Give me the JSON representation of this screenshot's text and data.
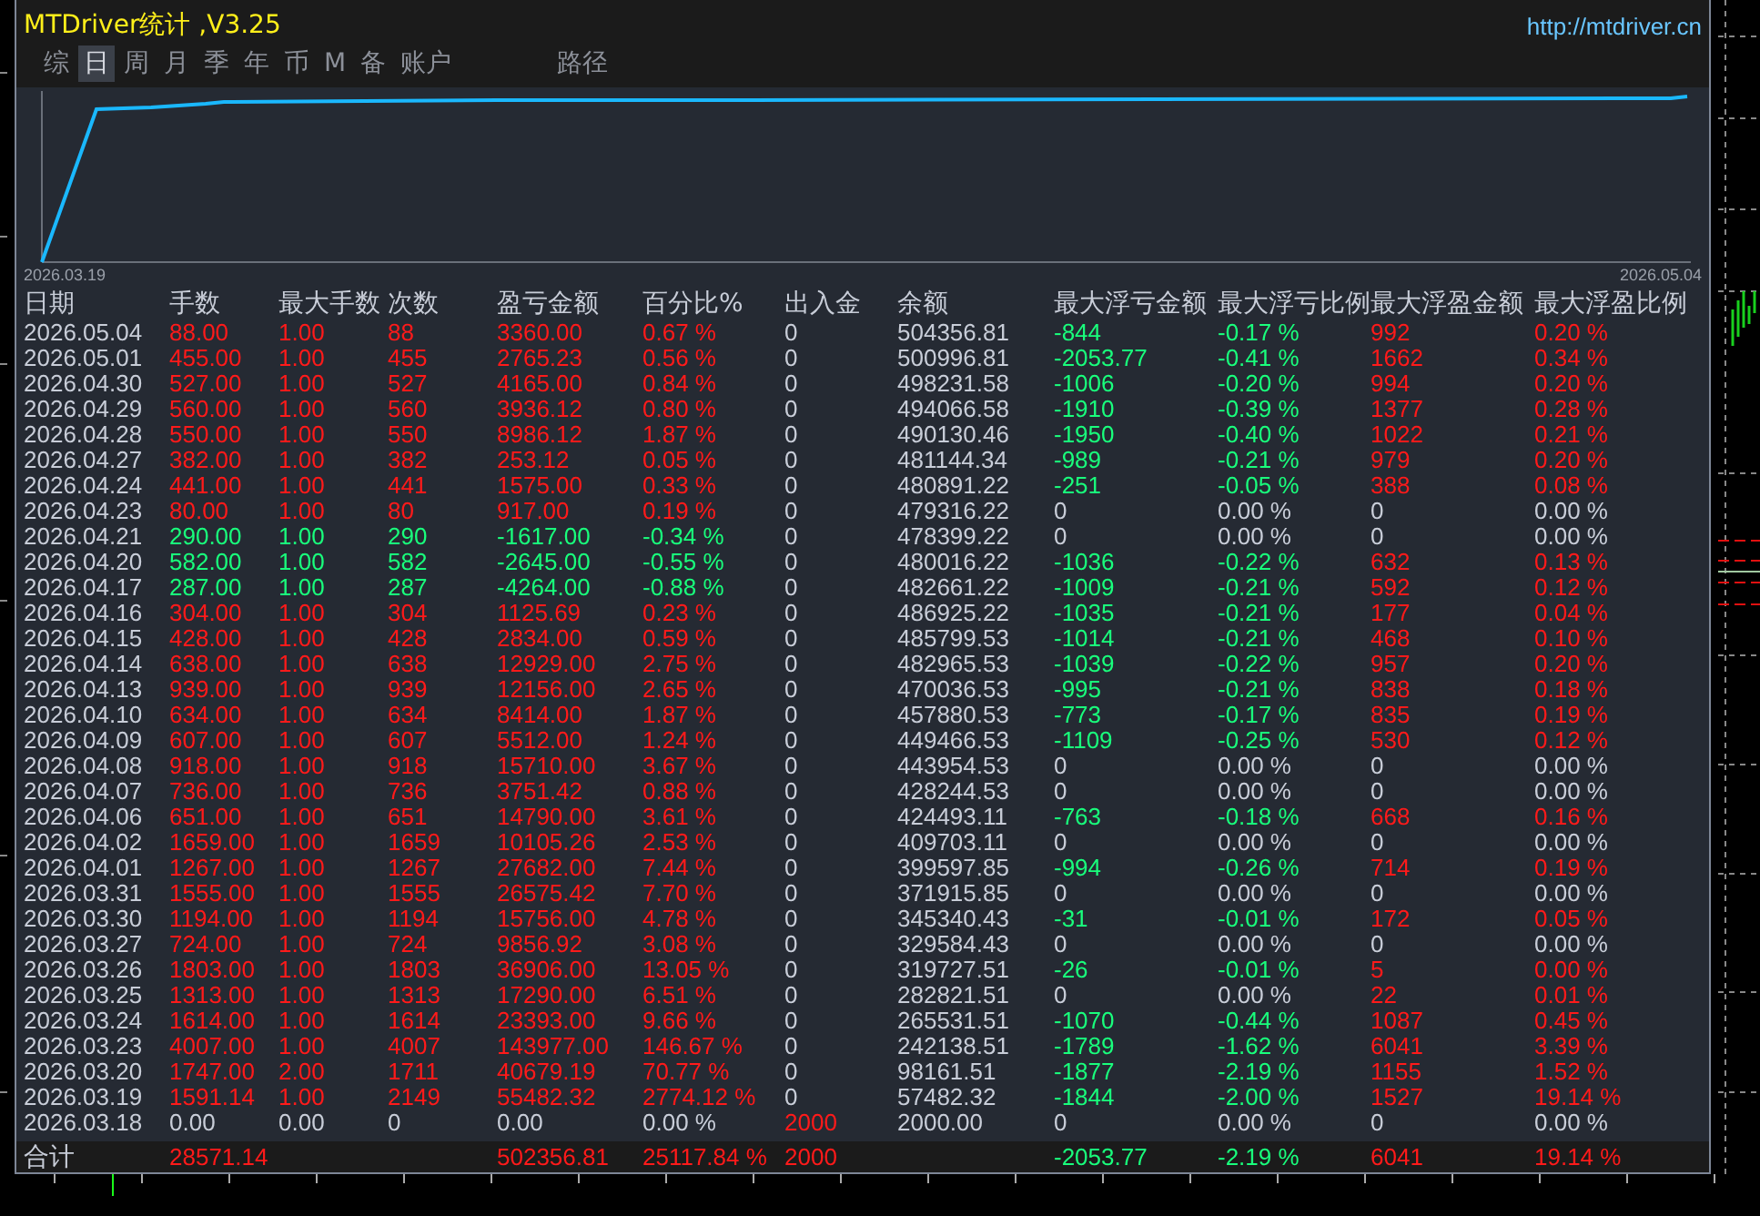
{
  "window": {
    "title": "MTDriver统计 ,V3.25",
    "url": "http://mtdriver.cn"
  },
  "tabs": [
    {
      "label": "综",
      "selected": false
    },
    {
      "label": "日",
      "selected": true
    },
    {
      "label": "周",
      "selected": false
    },
    {
      "label": "月",
      "selected": false
    },
    {
      "label": "季",
      "selected": false
    },
    {
      "label": "年",
      "selected": false
    },
    {
      "label": "币",
      "selected": false
    },
    {
      "label": "M",
      "selected": false
    },
    {
      "label": "备",
      "selected": false
    },
    {
      "label": "账户",
      "selected": false
    },
    {
      "label": "路径",
      "selected": false
    }
  ],
  "chart": {
    "start_label": "2026.03.19",
    "end_label": "2026.05.04"
  },
  "table": {
    "columns": [
      "日期",
      "手数",
      "最大手数",
      "次数",
      "盈亏金额",
      "百分比%",
      "出入金",
      "余额",
      "最大浮亏金额",
      "最大浮亏比例",
      "最大浮盈金额",
      "最大浮盈比例"
    ],
    "rows": [
      [
        {
          "text": "2026.05.04",
          "color": "#c8cdd8"
        },
        {
          "text": "88.00",
          "color": "#ff1a1a"
        },
        {
          "text": "1.00",
          "color": "#ff1a1a"
        },
        {
          "text": "88",
          "color": "#ff1a1a"
        },
        {
          "text": "3360.00",
          "color": "#ff1a1a"
        },
        {
          "text": "0.67 %",
          "color": "#ff1a1a"
        },
        {
          "text": "0",
          "color": "#c8cdd8"
        },
        {
          "text": "504356.81",
          "color": "#c8cdd8"
        },
        {
          "text": "-844",
          "color": "#19ff7c"
        },
        {
          "text": "-0.17 %",
          "color": "#19ff7c"
        },
        {
          "text": "992",
          "color": "#ff1a1a"
        },
        {
          "text": "0.20 %",
          "color": "#ff1a1a"
        }
      ],
      [
        {
          "text": "2026.05.01",
          "color": "#c8cdd8"
        },
        {
          "text": "455.00",
          "color": "#ff1a1a"
        },
        {
          "text": "1.00",
          "color": "#ff1a1a"
        },
        {
          "text": "455",
          "color": "#ff1a1a"
        },
        {
          "text": "2765.23",
          "color": "#ff1a1a"
        },
        {
          "text": "0.56 %",
          "color": "#ff1a1a"
        },
        {
          "text": "0",
          "color": "#c8cdd8"
        },
        {
          "text": "500996.81",
          "color": "#c8cdd8"
        },
        {
          "text": "-2053.77",
          "color": "#19ff7c"
        },
        {
          "text": "-0.41 %",
          "color": "#19ff7c"
        },
        {
          "text": "1662",
          "color": "#ff1a1a"
        },
        {
          "text": "0.34 %",
          "color": "#ff1a1a"
        }
      ],
      [
        {
          "text": "2026.04.30",
          "color": "#c8cdd8"
        },
        {
          "text": "527.00",
          "color": "#ff1a1a"
        },
        {
          "text": "1.00",
          "color": "#ff1a1a"
        },
        {
          "text": "527",
          "color": "#ff1a1a"
        },
        {
          "text": "4165.00",
          "color": "#ff1a1a"
        },
        {
          "text": "0.84 %",
          "color": "#ff1a1a"
        },
        {
          "text": "0",
          "color": "#c8cdd8"
        },
        {
          "text": "498231.58",
          "color": "#c8cdd8"
        },
        {
          "text": "-1006",
          "color": "#19ff7c"
        },
        {
          "text": "-0.20 %",
          "color": "#19ff7c"
        },
        {
          "text": "994",
          "color": "#ff1a1a"
        },
        {
          "text": "0.20 %",
          "color": "#ff1a1a"
        }
      ],
      [
        {
          "text": "2026.04.29",
          "color": "#c8cdd8"
        },
        {
          "text": "560.00",
          "color": "#ff1a1a"
        },
        {
          "text": "1.00",
          "color": "#ff1a1a"
        },
        {
          "text": "560",
          "color": "#ff1a1a"
        },
        {
          "text": "3936.12",
          "color": "#ff1a1a"
        },
        {
          "text": "0.80 %",
          "color": "#ff1a1a"
        },
        {
          "text": "0",
          "color": "#c8cdd8"
        },
        {
          "text": "494066.58",
          "color": "#c8cdd8"
        },
        {
          "text": "-1910",
          "color": "#19ff7c"
        },
        {
          "text": "-0.39 %",
          "color": "#19ff7c"
        },
        {
          "text": "1377",
          "color": "#ff1a1a"
        },
        {
          "text": "0.28 %",
          "color": "#ff1a1a"
        }
      ],
      [
        {
          "text": "2026.04.28",
          "color": "#c8cdd8"
        },
        {
          "text": "550.00",
          "color": "#ff1a1a"
        },
        {
          "text": "1.00",
          "color": "#ff1a1a"
        },
        {
          "text": "550",
          "color": "#ff1a1a"
        },
        {
          "text": "8986.12",
          "color": "#ff1a1a"
        },
        {
          "text": "1.87 %",
          "color": "#ff1a1a"
        },
        {
          "text": "0",
          "color": "#c8cdd8"
        },
        {
          "text": "490130.46",
          "color": "#c8cdd8"
        },
        {
          "text": "-1950",
          "color": "#19ff7c"
        },
        {
          "text": "-0.40 %",
          "color": "#19ff7c"
        },
        {
          "text": "1022",
          "color": "#ff1a1a"
        },
        {
          "text": "0.21 %",
          "color": "#ff1a1a"
        }
      ],
      [
        {
          "text": "2026.04.27",
          "color": "#c8cdd8"
        },
        {
          "text": "382.00",
          "color": "#ff1a1a"
        },
        {
          "text": "1.00",
          "color": "#ff1a1a"
        },
        {
          "text": "382",
          "color": "#ff1a1a"
        },
        {
          "text": "253.12",
          "color": "#ff1a1a"
        },
        {
          "text": "0.05 %",
          "color": "#ff1a1a"
        },
        {
          "text": "0",
          "color": "#c8cdd8"
        },
        {
          "text": "481144.34",
          "color": "#c8cdd8"
        },
        {
          "text": "-989",
          "color": "#19ff7c"
        },
        {
          "text": "-0.21 %",
          "color": "#19ff7c"
        },
        {
          "text": "979",
          "color": "#ff1a1a"
        },
        {
          "text": "0.20 %",
          "color": "#ff1a1a"
        }
      ],
      [
        {
          "text": "2026.04.24",
          "color": "#c8cdd8"
        },
        {
          "text": "441.00",
          "color": "#ff1a1a"
        },
        {
          "text": "1.00",
          "color": "#ff1a1a"
        },
        {
          "text": "441",
          "color": "#ff1a1a"
        },
        {
          "text": "1575.00",
          "color": "#ff1a1a"
        },
        {
          "text": "0.33 %",
          "color": "#ff1a1a"
        },
        {
          "text": "0",
          "color": "#c8cdd8"
        },
        {
          "text": "480891.22",
          "color": "#c8cdd8"
        },
        {
          "text": "-251",
          "color": "#19ff7c"
        },
        {
          "text": "-0.05 %",
          "color": "#19ff7c"
        },
        {
          "text": "388",
          "color": "#ff1a1a"
        },
        {
          "text": "0.08 %",
          "color": "#ff1a1a"
        }
      ],
      [
        {
          "text": "2026.04.23",
          "color": "#c8cdd8"
        },
        {
          "text": "80.00",
          "color": "#ff1a1a"
        },
        {
          "text": "1.00",
          "color": "#ff1a1a"
        },
        {
          "text": "80",
          "color": "#ff1a1a"
        },
        {
          "text": "917.00",
          "color": "#ff1a1a"
        },
        {
          "text": "0.19 %",
          "color": "#ff1a1a"
        },
        {
          "text": "0",
          "color": "#c8cdd8"
        },
        {
          "text": "479316.22",
          "color": "#c8cdd8"
        },
        {
          "text": "0",
          "color": "#c8cdd8"
        },
        {
          "text": "0.00 %",
          "color": "#c8cdd8"
        },
        {
          "text": "0",
          "color": "#c8cdd8"
        },
        {
          "text": "0.00 %",
          "color": "#c8cdd8"
        }
      ],
      [
        {
          "text": "2026.04.21",
          "color": "#c8cdd8"
        },
        {
          "text": "290.00",
          "color": "#19ff7c"
        },
        {
          "text": "1.00",
          "color": "#19ff7c"
        },
        {
          "text": "290",
          "color": "#19ff7c"
        },
        {
          "text": "-1617.00",
          "color": "#19ff7c"
        },
        {
          "text": "-0.34 %",
          "color": "#19ff7c"
        },
        {
          "text": "0",
          "color": "#c8cdd8"
        },
        {
          "text": "478399.22",
          "color": "#c8cdd8"
        },
        {
          "text": "0",
          "color": "#c8cdd8"
        },
        {
          "text": "0.00 %",
          "color": "#c8cdd8"
        },
        {
          "text": "0",
          "color": "#c8cdd8"
        },
        {
          "text": "0.00 %",
          "color": "#c8cdd8"
        }
      ],
      [
        {
          "text": "2026.04.20",
          "color": "#c8cdd8"
        },
        {
          "text": "582.00",
          "color": "#19ff7c"
        },
        {
          "text": "1.00",
          "color": "#19ff7c"
        },
        {
          "text": "582",
          "color": "#19ff7c"
        },
        {
          "text": "-2645.00",
          "color": "#19ff7c"
        },
        {
          "text": "-0.55 %",
          "color": "#19ff7c"
        },
        {
          "text": "0",
          "color": "#c8cdd8"
        },
        {
          "text": "480016.22",
          "color": "#c8cdd8"
        },
        {
          "text": "-1036",
          "color": "#19ff7c"
        },
        {
          "text": "-0.22 %",
          "color": "#19ff7c"
        },
        {
          "text": "632",
          "color": "#ff1a1a"
        },
        {
          "text": "0.13 %",
          "color": "#ff1a1a"
        }
      ],
      [
        {
          "text": "2026.04.17",
          "color": "#c8cdd8"
        },
        {
          "text": "287.00",
          "color": "#19ff7c"
        },
        {
          "text": "1.00",
          "color": "#19ff7c"
        },
        {
          "text": "287",
          "color": "#19ff7c"
        },
        {
          "text": "-4264.00",
          "color": "#19ff7c"
        },
        {
          "text": "-0.88 %",
          "color": "#19ff7c"
        },
        {
          "text": "0",
          "color": "#c8cdd8"
        },
        {
          "text": "482661.22",
          "color": "#c8cdd8"
        },
        {
          "text": "-1009",
          "color": "#19ff7c"
        },
        {
          "text": "-0.21 %",
          "color": "#19ff7c"
        },
        {
          "text": "592",
          "color": "#ff1a1a"
        },
        {
          "text": "0.12 %",
          "color": "#ff1a1a"
        }
      ],
      [
        {
          "text": "2026.04.16",
          "color": "#c8cdd8"
        },
        {
          "text": "304.00",
          "color": "#ff1a1a"
        },
        {
          "text": "1.00",
          "color": "#ff1a1a"
        },
        {
          "text": "304",
          "color": "#ff1a1a"
        },
        {
          "text": "1125.69",
          "color": "#ff1a1a"
        },
        {
          "text": "0.23 %",
          "color": "#ff1a1a"
        },
        {
          "text": "0",
          "color": "#c8cdd8"
        },
        {
          "text": "486925.22",
          "color": "#c8cdd8"
        },
        {
          "text": "-1035",
          "color": "#19ff7c"
        },
        {
          "text": "-0.21 %",
          "color": "#19ff7c"
        },
        {
          "text": "177",
          "color": "#ff1a1a"
        },
        {
          "text": "0.04 %",
          "color": "#ff1a1a"
        }
      ],
      [
        {
          "text": "2026.04.15",
          "color": "#c8cdd8"
        },
        {
          "text": "428.00",
          "color": "#ff1a1a"
        },
        {
          "text": "1.00",
          "color": "#ff1a1a"
        },
        {
          "text": "428",
          "color": "#ff1a1a"
        },
        {
          "text": "2834.00",
          "color": "#ff1a1a"
        },
        {
          "text": "0.59 %",
          "color": "#ff1a1a"
        },
        {
          "text": "0",
          "color": "#c8cdd8"
        },
        {
          "text": "485799.53",
          "color": "#c8cdd8"
        },
        {
          "text": "-1014",
          "color": "#19ff7c"
        },
        {
          "text": "-0.21 %",
          "color": "#19ff7c"
        },
        {
          "text": "468",
          "color": "#ff1a1a"
        },
        {
          "text": "0.10 %",
          "color": "#ff1a1a"
        }
      ],
      [
        {
          "text": "2026.04.14",
          "color": "#c8cdd8"
        },
        {
          "text": "638.00",
          "color": "#ff1a1a"
        },
        {
          "text": "1.00",
          "color": "#ff1a1a"
        },
        {
          "text": "638",
          "color": "#ff1a1a"
        },
        {
          "text": "12929.00",
          "color": "#ff1a1a"
        },
        {
          "text": "2.75 %",
          "color": "#ff1a1a"
        },
        {
          "text": "0",
          "color": "#c8cdd8"
        },
        {
          "text": "482965.53",
          "color": "#c8cdd8"
        },
        {
          "text": "-1039",
          "color": "#19ff7c"
        },
        {
          "text": "-0.22 %",
          "color": "#19ff7c"
        },
        {
          "text": "957",
          "color": "#ff1a1a"
        },
        {
          "text": "0.20 %",
          "color": "#ff1a1a"
        }
      ],
      [
        {
          "text": "2026.04.13",
          "color": "#c8cdd8"
        },
        {
          "text": "939.00",
          "color": "#ff1a1a"
        },
        {
          "text": "1.00",
          "color": "#ff1a1a"
        },
        {
          "text": "939",
          "color": "#ff1a1a"
        },
        {
          "text": "12156.00",
          "color": "#ff1a1a"
        },
        {
          "text": "2.65 %",
          "color": "#ff1a1a"
        },
        {
          "text": "0",
          "color": "#c8cdd8"
        },
        {
          "text": "470036.53",
          "color": "#c8cdd8"
        },
        {
          "text": "-995",
          "color": "#19ff7c"
        },
        {
          "text": "-0.21 %",
          "color": "#19ff7c"
        },
        {
          "text": "838",
          "color": "#ff1a1a"
        },
        {
          "text": "0.18 %",
          "color": "#ff1a1a"
        }
      ],
      [
        {
          "text": "2026.04.10",
          "color": "#c8cdd8"
        },
        {
          "text": "634.00",
          "color": "#ff1a1a"
        },
        {
          "text": "1.00",
          "color": "#ff1a1a"
        },
        {
          "text": "634",
          "color": "#ff1a1a"
        },
        {
          "text": "8414.00",
          "color": "#ff1a1a"
        },
        {
          "text": "1.87 %",
          "color": "#ff1a1a"
        },
        {
          "text": "0",
          "color": "#c8cdd8"
        },
        {
          "text": "457880.53",
          "color": "#c8cdd8"
        },
        {
          "text": "-773",
          "color": "#19ff7c"
        },
        {
          "text": "-0.17 %",
          "color": "#19ff7c"
        },
        {
          "text": "835",
          "color": "#ff1a1a"
        },
        {
          "text": "0.19 %",
          "color": "#ff1a1a"
        }
      ],
      [
        {
          "text": "2026.04.09",
          "color": "#c8cdd8"
        },
        {
          "text": "607.00",
          "color": "#ff1a1a"
        },
        {
          "text": "1.00",
          "color": "#ff1a1a"
        },
        {
          "text": "607",
          "color": "#ff1a1a"
        },
        {
          "text": "5512.00",
          "color": "#ff1a1a"
        },
        {
          "text": "1.24 %",
          "color": "#ff1a1a"
        },
        {
          "text": "0",
          "color": "#c8cdd8"
        },
        {
          "text": "449466.53",
          "color": "#c8cdd8"
        },
        {
          "text": "-1109",
          "color": "#19ff7c"
        },
        {
          "text": "-0.25 %",
          "color": "#19ff7c"
        },
        {
          "text": "530",
          "color": "#ff1a1a"
        },
        {
          "text": "0.12 %",
          "color": "#ff1a1a"
        }
      ],
      [
        {
          "text": "2026.04.08",
          "color": "#c8cdd8"
        },
        {
          "text": "918.00",
          "color": "#ff1a1a"
        },
        {
          "text": "1.00",
          "color": "#ff1a1a"
        },
        {
          "text": "918",
          "color": "#ff1a1a"
        },
        {
          "text": "15710.00",
          "color": "#ff1a1a"
        },
        {
          "text": "3.67 %",
          "color": "#ff1a1a"
        },
        {
          "text": "0",
          "color": "#c8cdd8"
        },
        {
          "text": "443954.53",
          "color": "#c8cdd8"
        },
        {
          "text": "0",
          "color": "#c8cdd8"
        },
        {
          "text": "0.00 %",
          "color": "#c8cdd8"
        },
        {
          "text": "0",
          "color": "#c8cdd8"
        },
        {
          "text": "0.00 %",
          "color": "#c8cdd8"
        }
      ],
      [
        {
          "text": "2026.04.07",
          "color": "#c8cdd8"
        },
        {
          "text": "736.00",
          "color": "#ff1a1a"
        },
        {
          "text": "1.00",
          "color": "#ff1a1a"
        },
        {
          "text": "736",
          "color": "#ff1a1a"
        },
        {
          "text": "3751.42",
          "color": "#ff1a1a"
        },
        {
          "text": "0.88 %",
          "color": "#ff1a1a"
        },
        {
          "text": "0",
          "color": "#c8cdd8"
        },
        {
          "text": "428244.53",
          "color": "#c8cdd8"
        },
        {
          "text": "0",
          "color": "#c8cdd8"
        },
        {
          "text": "0.00 %",
          "color": "#c8cdd8"
        },
        {
          "text": "0",
          "color": "#c8cdd8"
        },
        {
          "text": "0.00 %",
          "color": "#c8cdd8"
        }
      ],
      [
        {
          "text": "2026.04.06",
          "color": "#c8cdd8"
        },
        {
          "text": "651.00",
          "color": "#ff1a1a"
        },
        {
          "text": "1.00",
          "color": "#ff1a1a"
        },
        {
          "text": "651",
          "color": "#ff1a1a"
        },
        {
          "text": "14790.00",
          "color": "#ff1a1a"
        },
        {
          "text": "3.61 %",
          "color": "#ff1a1a"
        },
        {
          "text": "0",
          "color": "#c8cdd8"
        },
        {
          "text": "424493.11",
          "color": "#c8cdd8"
        },
        {
          "text": "-763",
          "color": "#19ff7c"
        },
        {
          "text": "-0.18 %",
          "color": "#19ff7c"
        },
        {
          "text": "668",
          "color": "#ff1a1a"
        },
        {
          "text": "0.16 %",
          "color": "#ff1a1a"
        }
      ],
      [
        {
          "text": "2026.04.02",
          "color": "#c8cdd8"
        },
        {
          "text": "1659.00",
          "color": "#ff1a1a"
        },
        {
          "text": "1.00",
          "color": "#ff1a1a"
        },
        {
          "text": "1659",
          "color": "#ff1a1a"
        },
        {
          "text": "10105.26",
          "color": "#ff1a1a"
        },
        {
          "text": "2.53 %",
          "color": "#ff1a1a"
        },
        {
          "text": "0",
          "color": "#c8cdd8"
        },
        {
          "text": "409703.11",
          "color": "#c8cdd8"
        },
        {
          "text": "0",
          "color": "#c8cdd8"
        },
        {
          "text": "0.00 %",
          "color": "#c8cdd8"
        },
        {
          "text": "0",
          "color": "#c8cdd8"
        },
        {
          "text": "0.00 %",
          "color": "#c8cdd8"
        }
      ],
      [
        {
          "text": "2026.04.01",
          "color": "#c8cdd8"
        },
        {
          "text": "1267.00",
          "color": "#ff1a1a"
        },
        {
          "text": "1.00",
          "color": "#ff1a1a"
        },
        {
          "text": "1267",
          "color": "#ff1a1a"
        },
        {
          "text": "27682.00",
          "color": "#ff1a1a"
        },
        {
          "text": "7.44 %",
          "color": "#ff1a1a"
        },
        {
          "text": "0",
          "color": "#c8cdd8"
        },
        {
          "text": "399597.85",
          "color": "#c8cdd8"
        },
        {
          "text": "-994",
          "color": "#19ff7c"
        },
        {
          "text": "-0.26 %",
          "color": "#19ff7c"
        },
        {
          "text": "714",
          "color": "#ff1a1a"
        },
        {
          "text": "0.19 %",
          "color": "#ff1a1a"
        }
      ],
      [
        {
          "text": "2026.03.31",
          "color": "#c8cdd8"
        },
        {
          "text": "1555.00",
          "color": "#ff1a1a"
        },
        {
          "text": "1.00",
          "color": "#ff1a1a"
        },
        {
          "text": "1555",
          "color": "#ff1a1a"
        },
        {
          "text": "26575.42",
          "color": "#ff1a1a"
        },
        {
          "text": "7.70 %",
          "color": "#ff1a1a"
        },
        {
          "text": "0",
          "color": "#c8cdd8"
        },
        {
          "text": "371915.85",
          "color": "#c8cdd8"
        },
        {
          "text": "0",
          "color": "#c8cdd8"
        },
        {
          "text": "0.00 %",
          "color": "#c8cdd8"
        },
        {
          "text": "0",
          "color": "#c8cdd8"
        },
        {
          "text": "0.00 %",
          "color": "#c8cdd8"
        }
      ],
      [
        {
          "text": "2026.03.30",
          "color": "#c8cdd8"
        },
        {
          "text": "1194.00",
          "color": "#ff1a1a"
        },
        {
          "text": "1.00",
          "color": "#ff1a1a"
        },
        {
          "text": "1194",
          "color": "#ff1a1a"
        },
        {
          "text": "15756.00",
          "color": "#ff1a1a"
        },
        {
          "text": "4.78 %",
          "color": "#ff1a1a"
        },
        {
          "text": "0",
          "color": "#c8cdd8"
        },
        {
          "text": "345340.43",
          "color": "#c8cdd8"
        },
        {
          "text": "-31",
          "color": "#19ff7c"
        },
        {
          "text": "-0.01 %",
          "color": "#19ff7c"
        },
        {
          "text": "172",
          "color": "#ff1a1a"
        },
        {
          "text": "0.05 %",
          "color": "#ff1a1a"
        }
      ],
      [
        {
          "text": "2026.03.27",
          "color": "#c8cdd8"
        },
        {
          "text": "724.00",
          "color": "#ff1a1a"
        },
        {
          "text": "1.00",
          "color": "#ff1a1a"
        },
        {
          "text": "724",
          "color": "#ff1a1a"
        },
        {
          "text": "9856.92",
          "color": "#ff1a1a"
        },
        {
          "text": "3.08 %",
          "color": "#ff1a1a"
        },
        {
          "text": "0",
          "color": "#c8cdd8"
        },
        {
          "text": "329584.43",
          "color": "#c8cdd8"
        },
        {
          "text": "0",
          "color": "#c8cdd8"
        },
        {
          "text": "0.00 %",
          "color": "#c8cdd8"
        },
        {
          "text": "0",
          "color": "#c8cdd8"
        },
        {
          "text": "0.00 %",
          "color": "#c8cdd8"
        }
      ],
      [
        {
          "text": "2026.03.26",
          "color": "#c8cdd8"
        },
        {
          "text": "1803.00",
          "color": "#ff1a1a"
        },
        {
          "text": "1.00",
          "color": "#ff1a1a"
        },
        {
          "text": "1803",
          "color": "#ff1a1a"
        },
        {
          "text": "36906.00",
          "color": "#ff1a1a"
        },
        {
          "text": "13.05 %",
          "color": "#ff1a1a"
        },
        {
          "text": "0",
          "color": "#c8cdd8"
        },
        {
          "text": "319727.51",
          "color": "#c8cdd8"
        },
        {
          "text": "-26",
          "color": "#19ff7c"
        },
        {
          "text": "-0.01 %",
          "color": "#19ff7c"
        },
        {
          "text": "5",
          "color": "#ff1a1a"
        },
        {
          "text": "0.00 %",
          "color": "#ff1a1a"
        }
      ],
      [
        {
          "text": "2026.03.25",
          "color": "#c8cdd8"
        },
        {
          "text": "1313.00",
          "color": "#ff1a1a"
        },
        {
          "text": "1.00",
          "color": "#ff1a1a"
        },
        {
          "text": "1313",
          "color": "#ff1a1a"
        },
        {
          "text": "17290.00",
          "color": "#ff1a1a"
        },
        {
          "text": "6.51 %",
          "color": "#ff1a1a"
        },
        {
          "text": "0",
          "color": "#c8cdd8"
        },
        {
          "text": "282821.51",
          "color": "#c8cdd8"
        },
        {
          "text": "0",
          "color": "#c8cdd8"
        },
        {
          "text": "0.00 %",
          "color": "#c8cdd8"
        },
        {
          "text": "22",
          "color": "#ff1a1a"
        },
        {
          "text": "0.01 %",
          "color": "#ff1a1a"
        }
      ],
      [
        {
          "text": "2026.03.24",
          "color": "#c8cdd8"
        },
        {
          "text": "1614.00",
          "color": "#ff1a1a"
        },
        {
          "text": "1.00",
          "color": "#ff1a1a"
        },
        {
          "text": "1614",
          "color": "#ff1a1a"
        },
        {
          "text": "23393.00",
          "color": "#ff1a1a"
        },
        {
          "text": "9.66 %",
          "color": "#ff1a1a"
        },
        {
          "text": "0",
          "color": "#c8cdd8"
        },
        {
          "text": "265531.51",
          "color": "#c8cdd8"
        },
        {
          "text": "-1070",
          "color": "#19ff7c"
        },
        {
          "text": "-0.44 %",
          "color": "#19ff7c"
        },
        {
          "text": "1087",
          "color": "#ff1a1a"
        },
        {
          "text": "0.45 %",
          "color": "#ff1a1a"
        }
      ],
      [
        {
          "text": "2026.03.23",
          "color": "#c8cdd8"
        },
        {
          "text": "4007.00",
          "color": "#ff1a1a"
        },
        {
          "text": "1.00",
          "color": "#ff1a1a"
        },
        {
          "text": "4007",
          "color": "#ff1a1a"
        },
        {
          "text": "143977.00",
          "color": "#ff1a1a"
        },
        {
          "text": "146.67 %",
          "color": "#ff1a1a"
        },
        {
          "text": "0",
          "color": "#c8cdd8"
        },
        {
          "text": "242138.51",
          "color": "#c8cdd8"
        },
        {
          "text": "-1789",
          "color": "#19ff7c"
        },
        {
          "text": "-1.62 %",
          "color": "#19ff7c"
        },
        {
          "text": "6041",
          "color": "#ff1a1a"
        },
        {
          "text": "3.39 %",
          "color": "#ff1a1a"
        }
      ],
      [
        {
          "text": "2026.03.20",
          "color": "#c8cdd8"
        },
        {
          "text": "1747.00",
          "color": "#ff1a1a"
        },
        {
          "text": "2.00",
          "color": "#ff1a1a"
        },
        {
          "text": "1711",
          "color": "#ff1a1a"
        },
        {
          "text": "40679.19",
          "color": "#ff1a1a"
        },
        {
          "text": "70.77 %",
          "color": "#ff1a1a"
        },
        {
          "text": "0",
          "color": "#c8cdd8"
        },
        {
          "text": "98161.51",
          "color": "#c8cdd8"
        },
        {
          "text": "-1877",
          "color": "#19ff7c"
        },
        {
          "text": "-2.19 %",
          "color": "#19ff7c"
        },
        {
          "text": "1155",
          "color": "#ff1a1a"
        },
        {
          "text": "1.52 %",
          "color": "#ff1a1a"
        }
      ],
      [
        {
          "text": "2026.03.19",
          "color": "#c8cdd8"
        },
        {
          "text": "1591.14",
          "color": "#ff1a1a"
        },
        {
          "text": "1.00",
          "color": "#ff1a1a"
        },
        {
          "text": "2149",
          "color": "#ff1a1a"
        },
        {
          "text": "55482.32",
          "color": "#ff1a1a"
        },
        {
          "text": "2774.12 %",
          "color": "#ff1a1a"
        },
        {
          "text": "0",
          "color": "#c8cdd8"
        },
        {
          "text": "57482.32",
          "color": "#c8cdd8"
        },
        {
          "text": "-1844",
          "color": "#19ff7c"
        },
        {
          "text": "-2.00 %",
          "color": "#19ff7c"
        },
        {
          "text": "1527",
          "color": "#ff1a1a"
        },
        {
          "text": "19.14 %",
          "color": "#ff1a1a"
        }
      ],
      [
        {
          "text": "2026.03.18",
          "color": "#c8cdd8"
        },
        {
          "text": "0.00",
          "color": "#c8cdd8"
        },
        {
          "text": "0.00",
          "color": "#c8cdd8"
        },
        {
          "text": "0",
          "color": "#c8cdd8"
        },
        {
          "text": "0.00",
          "color": "#c8cdd8"
        },
        {
          "text": "0.00 %",
          "color": "#c8cdd8"
        },
        {
          "text": "2000",
          "color": "#ff1a1a"
        },
        {
          "text": "2000.00",
          "color": "#c8cdd8"
        },
        {
          "text": "0",
          "color": "#c8cdd8"
        },
        {
          "text": "0.00 %",
          "color": "#c8cdd8"
        },
        {
          "text": "0",
          "color": "#c8cdd8"
        },
        {
          "text": "0.00 %",
          "color": "#c8cdd8"
        }
      ]
    ],
    "total": {
      "label": {
        "text": "合计",
        "color": "#c8cdd8"
      },
      "lots": {
        "text": "28571.14",
        "color": "#ff1a1a"
      },
      "pnl": {
        "text": "502356.81",
        "color": "#ff1a1a"
      },
      "pct": {
        "text": "25117.84 %",
        "color": "#ff1a1a"
      },
      "flow": {
        "text": "2000",
        "color": "#ff1a1a"
      },
      "float_loss": {
        "text": "-2053.77",
        "color": "#19ff7c"
      },
      "float_loss_pct": {
        "text": "-2.19 %",
        "color": "#19ff7c"
      },
      "float_profit": {
        "text": "6041",
        "color": "#ff1a1a"
      },
      "float_profit_pct": {
        "text": "19.14 %",
        "color": "#ff1a1a"
      }
    }
  }
}
